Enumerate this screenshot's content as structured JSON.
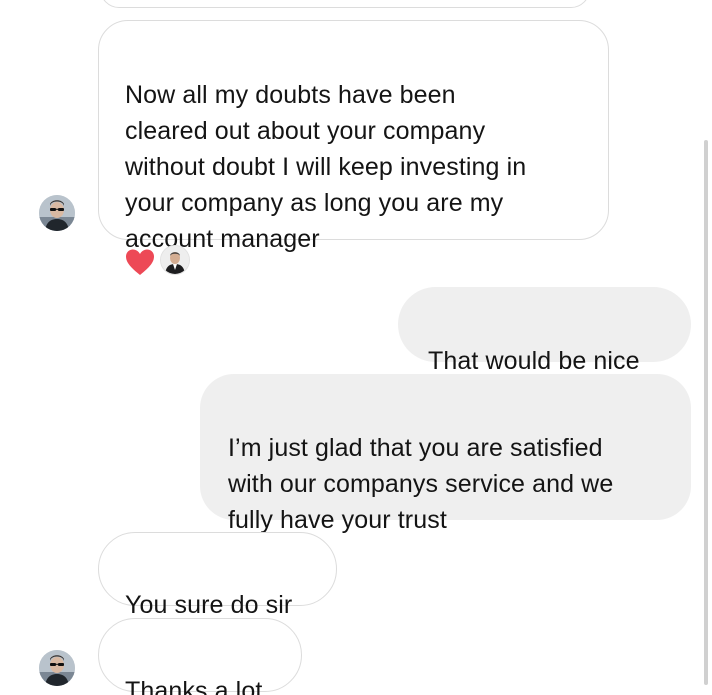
{
  "conversation": {
    "messages": [
      {
        "direction": "received",
        "text": "Now all my doubts have been\ncleared out about your company\nwithout doubt I will keep investing in\nyour company as long you are my\naccount manager",
        "reactions": [
          "heart",
          "avatar"
        ]
      },
      {
        "direction": "sent",
        "text": "That would be nice"
      },
      {
        "direction": "sent",
        "text": "I’m just glad that you are satisfied\nwith our companys service and we\nfully have your trust"
      },
      {
        "direction": "received",
        "text": "You sure do sir"
      },
      {
        "direction": "received",
        "text": "Thanks a lot"
      }
    ]
  },
  "colors": {
    "sent_bubble": "#efefef",
    "received_border": "#dcdcdc",
    "heart": "#ed4956",
    "text": "#141414"
  },
  "icons": {
    "contact_avatar": "person-with-sunglasses-avatar",
    "reaction_heart": "heart-icon",
    "reaction_user": "user-avatar"
  }
}
